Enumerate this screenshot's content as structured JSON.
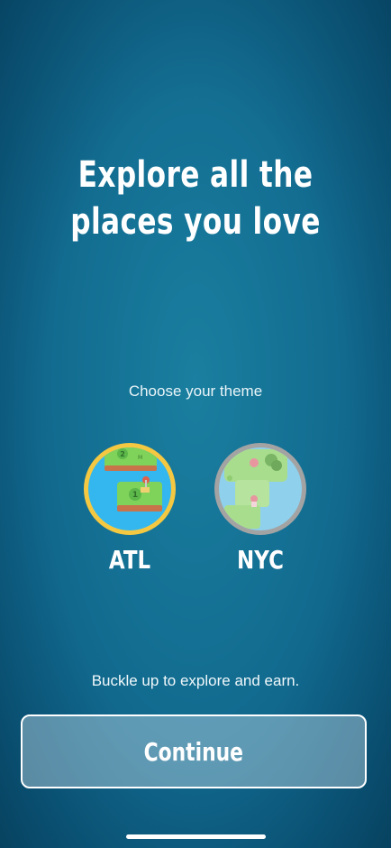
{
  "header": {
    "headline": "Explore all the places you love"
  },
  "theme_picker": {
    "prompt": "Choose your theme",
    "options": [
      {
        "label": "ATL",
        "selected": true,
        "ring_color": "#F5C842"
      },
      {
        "label": "NYC",
        "selected": false,
        "ring_color": "#A3A3A3"
      }
    ]
  },
  "footer": {
    "tagline": "Buckle up to explore and earn.",
    "continue_label": "Continue"
  },
  "colors": {
    "background": "#136E92",
    "button_fill": "#8BB4C8",
    "selected_ring": "#F5C842",
    "unselected_ring": "#A3A3A3"
  },
  "icons": {
    "atl": "atl-theme-map-icon",
    "nyc": "nyc-theme-map-icon"
  }
}
